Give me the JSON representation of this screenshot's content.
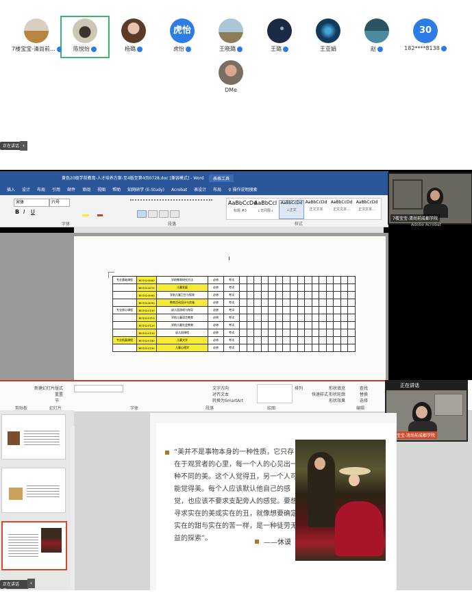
{
  "participants": [
    {
      "name": "7楼宝宝-清尚前...",
      "badge": true,
      "avatar": "photo-group"
    },
    {
      "name": "陈悦怡",
      "badge": true,
      "avatar": "photo-sketch",
      "selected": true
    },
    {
      "name": "杨璐",
      "badge": true,
      "avatar": "photo-woman"
    },
    {
      "name": "虎怡",
      "avatar_text": "虎怡",
      "badge": true
    },
    {
      "name": "王晓璐",
      "badge": true,
      "avatar": "photo-field"
    },
    {
      "name": "王璐",
      "badge": true,
      "avatar": "photo-night"
    },
    {
      "name": "王亚娟",
      "badge": false,
      "avatar": "photo-blue"
    },
    {
      "name": "赵",
      "badge": true,
      "avatar": "photo-lake"
    },
    {
      "name": "182****8138",
      "avatar_text": "30",
      "badge": true
    },
    {
      "name": "DMe",
      "badge": false,
      "avatar": "photo-man"
    }
  ],
  "collapse_pill_1": "正在讲话中...",
  "word": {
    "title": "黄色20级学前教育-人才培养方案-至4版至第4页0728.doc [兼容模式] - Word",
    "tools_tab": "表格工具",
    "menu": [
      "插入",
      "设计",
      "布局",
      "引用",
      "邮件",
      "审阅",
      "视图",
      "帮助",
      "知网研学 (E-Study)",
      "Acrobat",
      "表设计",
      "布局",
      "♀ 操作说明搜索"
    ],
    "font_name": "宋体",
    "font_size": "六号",
    "group_font": "字体",
    "group_para": "段落",
    "group_styles": "样式",
    "styles": [
      "AaBbCcDd",
      "AaBbCcI",
      "AaBbCcDd",
      "AaBbCcDd",
      "AaBbCcDd",
      "AaBbCcDd"
    ],
    "style_names": [
      "标题 #3",
      "↓无间隔↓",
      "↓正文",
      "正文文本",
      "正文文本...",
      "正文文本..."
    ],
    "table_rows": [
      {
        "code": "B01020060",
        "name": "学前教育研究方法",
        "a": "必修",
        "b": "考试"
      },
      {
        "code": "B01020070",
        "name": "儿童发展",
        "a": "必修",
        "b": "考试"
      },
      {
        "code": "B01020080",
        "name": "学前儿童卫生与保育",
        "a": "必修",
        "b": "考试"
      },
      {
        "code": "B01020090",
        "name": "教育活动设计与实施",
        "a": "必修",
        "b": "考试"
      },
      {
        "code": "B01020100",
        "name": "幼儿园游戏与指导",
        "a": "必修",
        "b": "考试"
      },
      {
        "code": "B01020110",
        "name": "学前儿童语言教育",
        "a": "必修",
        "b": "考试"
      },
      {
        "code": "B01020120",
        "name": "学前儿童社会教育",
        "a": "必修",
        "b": "考试"
      },
      {
        "code": "B01020130",
        "name": "幼儿园课程",
        "a": "必修",
        "b": "考试"
      },
      {
        "code": "B01020140",
        "name": "儿童文学",
        "a": "必修",
        "b": "考试"
      },
      {
        "code": "B01020150",
        "name": "儿童心理学",
        "a": "必修",
        "b": "考试"
      }
    ],
    "table_groups": [
      "专业基础课程",
      "专业核心课程",
      "专业拓展课程"
    ],
    "cam_label": "7楼宝宝-清尚前成都学院",
    "cam_sub": "Adobe Acrobat"
  },
  "ppt": {
    "font_box": "",
    "groups": [
      "剪贴板",
      "幻灯片",
      "字体",
      "段落",
      "绘图",
      "编辑"
    ],
    "buttons": [
      "新建幻灯片",
      "版式",
      "重置",
      "节",
      "文字方向",
      "对齐文本",
      "转换为SmartArt",
      "排列",
      "快速样式",
      "形状填充",
      "形状轮廓",
      "形状效果",
      "查找",
      "替换",
      "选择"
    ],
    "cam_title": "正在讲话",
    "cam_label": "7楼宝宝-清尚前成都学院",
    "quote": "“美并不是事物本身的一种性质，它只存在于观赏者的心里，每一个人的心见出一种不同的美。这个人觉得丑，另一个人可能觉得美。每个人应该默认他自己的感觉，也应该不要求支配旁人的感觉。要想寻求实在的美或实在的丑，就像想要确定实在的甜与实在的苦一样，是一种徒劳无益的探索”。",
    "author": "——休谟",
    "thumb_nums": [
      "",
      "",
      ""
    ],
    "collapse_pill_2": "正在讲话中..."
  }
}
